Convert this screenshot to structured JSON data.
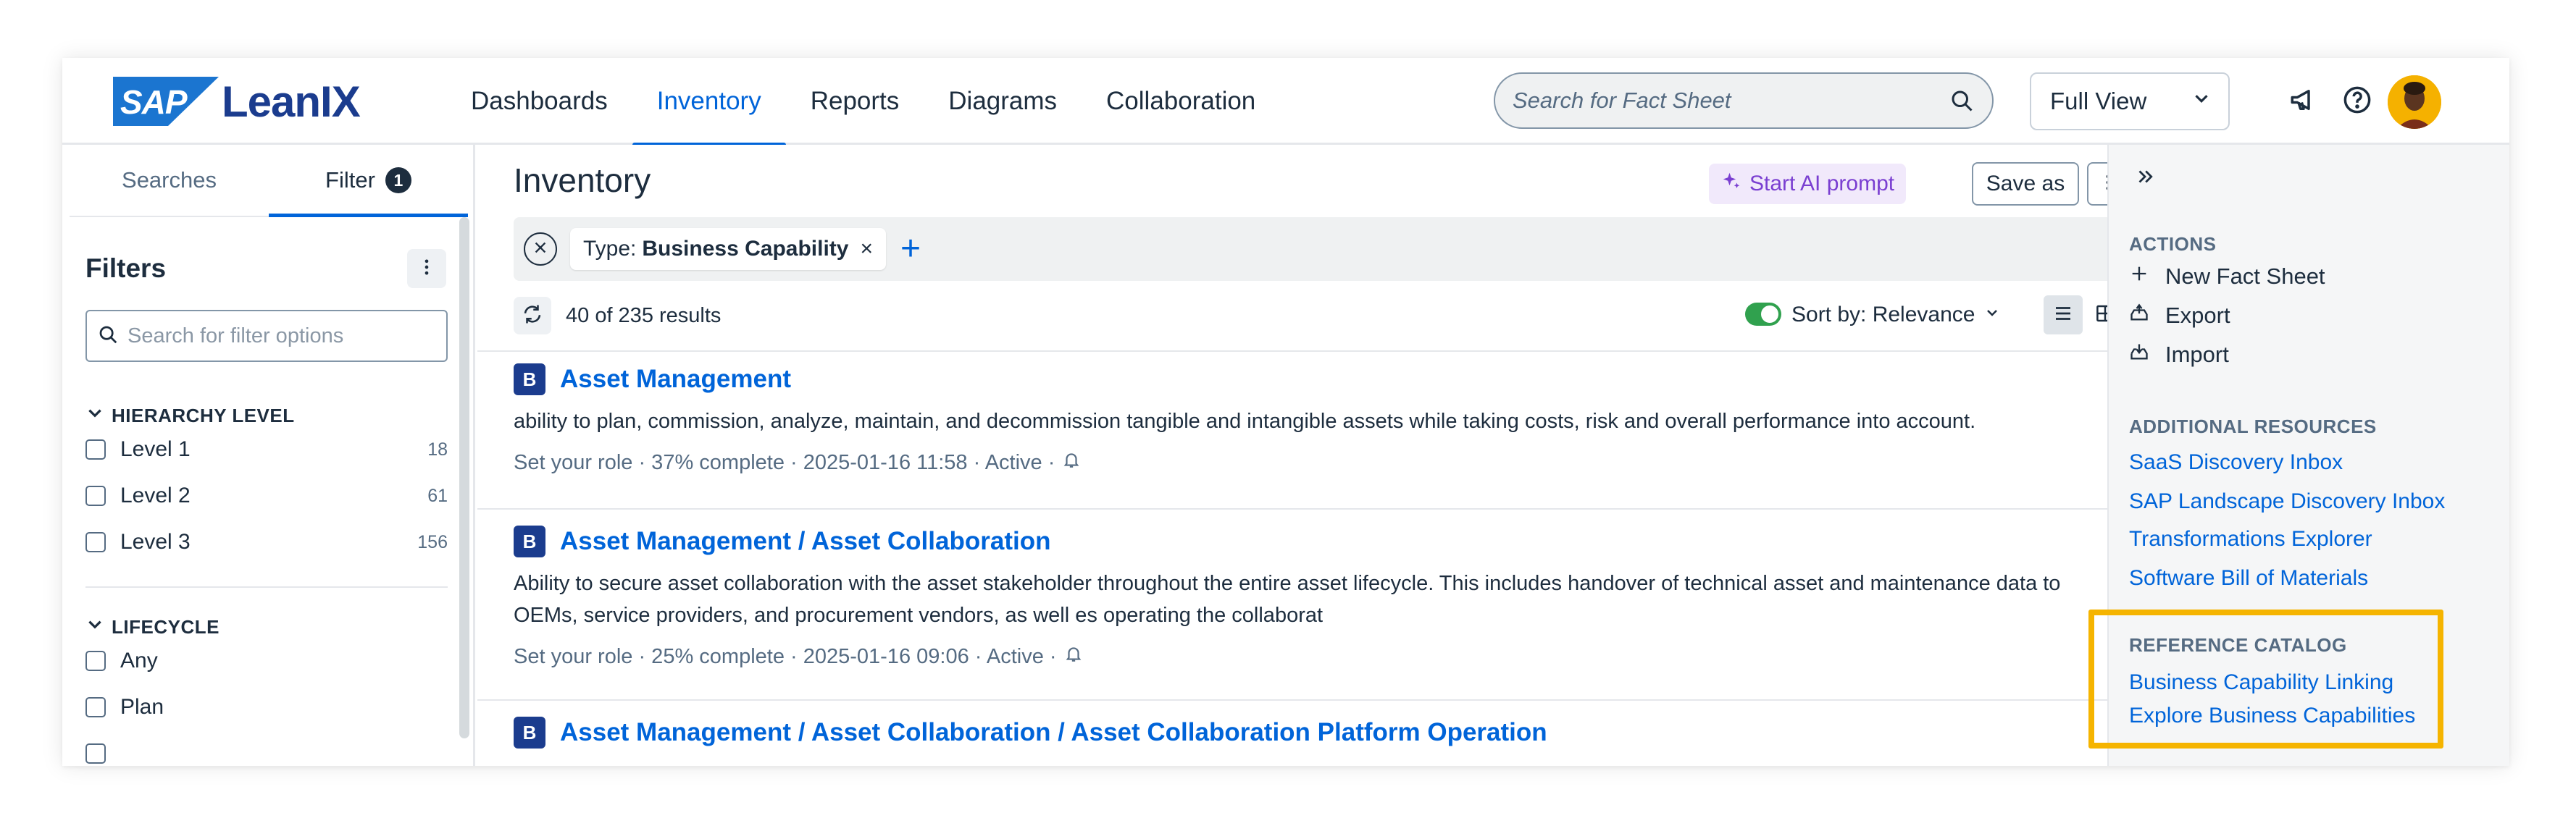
{
  "header": {
    "logo_sap": "SAP",
    "logo_word": "LeanIX",
    "nav": [
      "Dashboards",
      "Inventory",
      "Reports",
      "Diagrams",
      "Collaboration"
    ],
    "active_nav": "Inventory",
    "search_placeholder": "Search for Fact Sheet",
    "view_select": "Full View",
    "icons": [
      "megaphone-icon",
      "help-icon",
      "avatar"
    ]
  },
  "left_panel": {
    "tabs": [
      "Searches",
      "Filter"
    ],
    "filter_count": "1",
    "title": "Filters",
    "search_placeholder": "Search for filter options",
    "hierarchy": {
      "title": "HIERARCHY LEVEL",
      "items": [
        {
          "label": "Level 1",
          "count": "18"
        },
        {
          "label": "Level 2",
          "count": "61"
        },
        {
          "label": "Level 3",
          "count": "156"
        }
      ]
    },
    "lifecycle": {
      "title": "LIFECYCLE",
      "items": [
        {
          "label": "Any"
        },
        {
          "label": "Plan"
        }
      ]
    }
  },
  "main": {
    "title": "Inventory",
    "ai_prompt": "Start AI prompt",
    "save_as": "Save as",
    "chip_prefix": "Type:",
    "chip_value": "Business Capability",
    "chip_remove": "×",
    "add": "+",
    "results": "40 of 235 results",
    "sort": "Sort by: Relevance",
    "items": [
      {
        "badge": "B",
        "name": "Asset Management",
        "desc": "ability to plan, commission, analyze, maintain, and decommission tangible and intangible assets while taking costs, risk and overall performance into account.",
        "meta": "Set your role · 37% complete · 2025-01-16 11:58 · Active ·"
      },
      {
        "badge": "B",
        "name": "Asset Management / Asset Collaboration",
        "desc": "Ability to secure asset collaboration with the asset stakeholder throughout the entire asset lifecycle. This includes handover of technical asset and maintenance data to OEMs, service providers, and procurement vendors, as well es operating the collaborat",
        "meta": "Set your role · 25% complete · 2025-01-16 09:06 · Active ·"
      },
      {
        "badge": "B",
        "name": "Asset Management / Asset Collaboration / Asset Collaboration Platform Operation"
      }
    ]
  },
  "right_panel": {
    "actions_title": "ACTIONS",
    "actions": [
      "New Fact Sheet",
      "Export",
      "Import"
    ],
    "resources_title": "ADDITIONAL RESOURCES",
    "resources": [
      "SaaS Discovery Inbox",
      "SAP Landscape Discovery Inbox",
      "Transformations Explorer",
      "Software Bill of Materials"
    ],
    "catalog_title": "REFERENCE CATALOG",
    "catalog": [
      "Business Capability Linking",
      "Explore Business Capabilities"
    ]
  },
  "colors": {
    "accent": "#0064d9",
    "brand": "#1b3c8e",
    "highlight": "#f5b400",
    "ai": "#7a3fd1",
    "toggle_on": "#30a14e"
  }
}
